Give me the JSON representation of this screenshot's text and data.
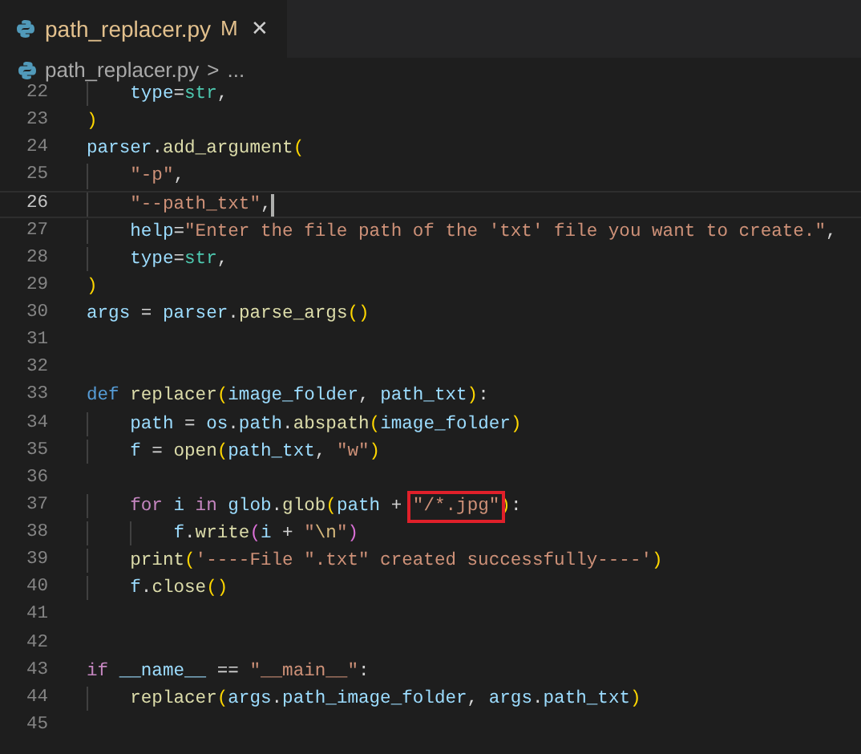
{
  "tabs": [
    {
      "label": "path_replacer.py",
      "badge": "M",
      "close": "✕",
      "selected": true
    }
  ],
  "breadcrumb": {
    "file": "path_replacer.py",
    "separator": ">",
    "more": "..."
  },
  "lines": [
    {
      "number": "22",
      "current": false,
      "tokens": [
        {
          "t": "    type",
          "kind": "var"
        },
        {
          "t": "=",
          "kind": "plain"
        },
        {
          "t": "str",
          "kind": "type"
        },
        {
          "t": ",",
          "kind": "plain"
        }
      ]
    },
    {
      "number": "23",
      "current": false,
      "tokens": [
        {
          "t": ")",
          "kind": "br1"
        }
      ]
    },
    {
      "number": "24",
      "current": false,
      "tokens": [
        {
          "t": "parser",
          "kind": "var"
        },
        {
          "t": ".",
          "kind": "plain"
        },
        {
          "t": "add_argument",
          "kind": "fn"
        },
        {
          "t": "(",
          "kind": "br1"
        }
      ]
    },
    {
      "number": "25",
      "current": false,
      "tokens": [
        {
          "t": "    \"-p\"",
          "kind": "str"
        },
        {
          "t": ",",
          "kind": "plain"
        }
      ]
    },
    {
      "number": "26",
      "current": true,
      "tokens": [
        {
          "t": "    \"--path_txt\"",
          "kind": "str"
        },
        {
          "t": ",",
          "kind": "plain"
        }
      ]
    },
    {
      "number": "27",
      "current": false,
      "tokens": [
        {
          "t": "    help",
          "kind": "var"
        },
        {
          "t": "=",
          "kind": "plain"
        },
        {
          "t": "\"Enter the file path of the 'txt' file you want to create.\"",
          "kind": "str"
        },
        {
          "t": ",",
          "kind": "plain"
        }
      ]
    },
    {
      "number": "28",
      "current": false,
      "tokens": [
        {
          "t": "    type",
          "kind": "var"
        },
        {
          "t": "=",
          "kind": "plain"
        },
        {
          "t": "str",
          "kind": "type"
        },
        {
          "t": ",",
          "kind": "plain"
        }
      ]
    },
    {
      "number": "29",
      "current": false,
      "tokens": [
        {
          "t": ")",
          "kind": "br1"
        }
      ]
    },
    {
      "number": "30",
      "current": false,
      "tokens": [
        {
          "t": "args",
          "kind": "var"
        },
        {
          "t": " = ",
          "kind": "plain"
        },
        {
          "t": "parser",
          "kind": "var"
        },
        {
          "t": ".",
          "kind": "plain"
        },
        {
          "t": "parse_args",
          "kind": "fn"
        },
        {
          "t": "()",
          "kind": "br1"
        }
      ]
    },
    {
      "number": "31",
      "current": false
    },
    {
      "number": "32",
      "current": false
    },
    {
      "number": "33",
      "current": false,
      "tokens": [
        {
          "t": "def ",
          "kind": "kw"
        },
        {
          "t": "replacer",
          "kind": "fn"
        },
        {
          "t": "(",
          "kind": "br1"
        },
        {
          "t": "image_folder",
          "kind": "var"
        },
        {
          "t": ", ",
          "kind": "plain"
        },
        {
          "t": "path_txt",
          "kind": "var"
        },
        {
          "t": ")",
          "kind": "br1"
        },
        {
          "t": ":",
          "kind": "plain"
        }
      ]
    },
    {
      "number": "34",
      "current": false,
      "tokens": [
        {
          "t": "    path",
          "kind": "var"
        },
        {
          "t": " = ",
          "kind": "plain"
        },
        {
          "t": "os",
          "kind": "var"
        },
        {
          "t": ".",
          "kind": "plain"
        },
        {
          "t": "path",
          "kind": "var"
        },
        {
          "t": ".",
          "kind": "plain"
        },
        {
          "t": "abspath",
          "kind": "fn"
        },
        {
          "t": "(",
          "kind": "br1"
        },
        {
          "t": "image_folder",
          "kind": "var"
        },
        {
          "t": ")",
          "kind": "br1"
        }
      ]
    },
    {
      "number": "35",
      "current": false,
      "tokens": [
        {
          "t": "    f",
          "kind": "var"
        },
        {
          "t": " = ",
          "kind": "plain"
        },
        {
          "t": "open",
          "kind": "fn"
        },
        {
          "t": "(",
          "kind": "br1"
        },
        {
          "t": "path_txt",
          "kind": "var"
        },
        {
          "t": ", ",
          "kind": "plain"
        },
        {
          "t": "\"w\"",
          "kind": "str"
        },
        {
          "t": ")",
          "kind": "br1"
        }
      ]
    },
    {
      "number": "36",
      "current": false
    },
    {
      "number": "37",
      "current": false,
      "tokens": [
        {
          "t": "    for ",
          "kind": "ctrl"
        },
        {
          "t": "i ",
          "kind": "var"
        },
        {
          "t": "in ",
          "kind": "ctrl"
        },
        {
          "t": "glob",
          "kind": "var"
        },
        {
          "t": ".",
          "kind": "plain"
        },
        {
          "t": "glob",
          "kind": "fn"
        },
        {
          "t": "(",
          "kind": "br1"
        },
        {
          "t": "path",
          "kind": "var"
        },
        {
          "t": " + ",
          "kind": "plain"
        },
        {
          "t": "\"/*.jpg\"",
          "kind": "str",
          "boxed": true
        },
        {
          "t": ")",
          "kind": "br1"
        },
        {
          "t": ":",
          "kind": "plain"
        }
      ]
    },
    {
      "number": "38",
      "current": false,
      "tokens": [
        {
          "t": "        f",
          "kind": "var"
        },
        {
          "t": ".",
          "kind": "plain"
        },
        {
          "t": "write",
          "kind": "fn"
        },
        {
          "t": "(",
          "kind": "br2"
        },
        {
          "t": "i",
          "kind": "var"
        },
        {
          "t": " + ",
          "kind": "plain"
        },
        {
          "t": "\"",
          "kind": "str"
        },
        {
          "t": "\\n",
          "kind": "esc"
        },
        {
          "t": "\"",
          "kind": "str"
        },
        {
          "t": ")",
          "kind": "br2"
        }
      ]
    },
    {
      "number": "39",
      "current": false,
      "tokens": [
        {
          "t": "    print",
          "kind": "fn"
        },
        {
          "t": "(",
          "kind": "br1"
        },
        {
          "t": "'----File \".txt\" created successfully----'",
          "kind": "str"
        },
        {
          "t": ")",
          "kind": "br1"
        }
      ]
    },
    {
      "number": "40",
      "current": false,
      "tokens": [
        {
          "t": "    f",
          "kind": "var"
        },
        {
          "t": ".",
          "kind": "plain"
        },
        {
          "t": "close",
          "kind": "fn"
        },
        {
          "t": "()",
          "kind": "br1"
        }
      ]
    },
    {
      "number": "41",
      "current": false
    },
    {
      "number": "42",
      "current": false
    },
    {
      "number": "43",
      "current": false,
      "tokens": [
        {
          "t": "if ",
          "kind": "ctrl"
        },
        {
          "t": "__name__",
          "kind": "var"
        },
        {
          "t": " == ",
          "kind": "plain"
        },
        {
          "t": "\"__main__\"",
          "kind": "str"
        },
        {
          "t": ":",
          "kind": "plain"
        }
      ]
    },
    {
      "number": "44",
      "current": false,
      "tokens": [
        {
          "t": "    replacer",
          "kind": "fn"
        },
        {
          "t": "(",
          "kind": "br1"
        },
        {
          "t": "args",
          "kind": "var"
        },
        {
          "t": ".",
          "kind": "plain"
        },
        {
          "t": "path_image_folder",
          "kind": "var"
        },
        {
          "t": ", ",
          "kind": "plain"
        },
        {
          "t": "args",
          "kind": "var"
        },
        {
          "t": ".",
          "kind": "plain"
        },
        {
          "t": "path_txt",
          "kind": "var"
        },
        {
          "t": ")",
          "kind": "br1"
        }
      ]
    },
    {
      "number": "45",
      "current": false
    }
  ]
}
